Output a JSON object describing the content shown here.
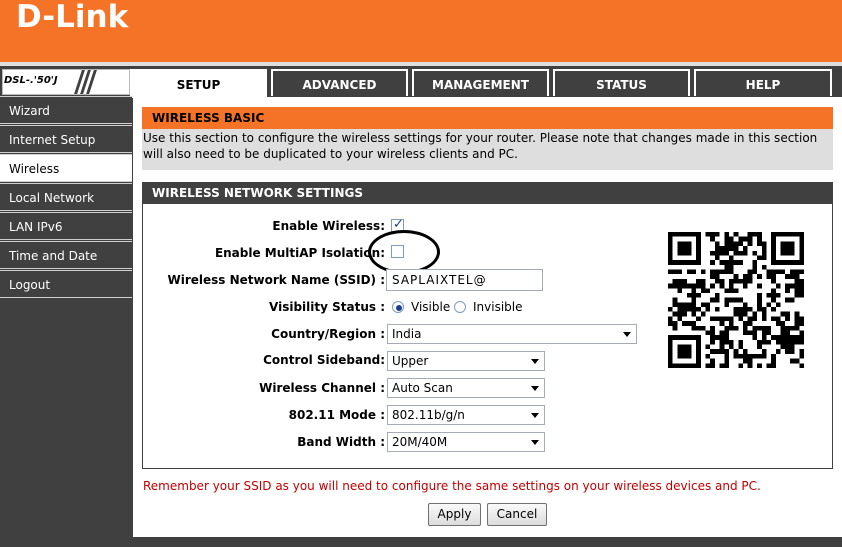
{
  "brand": {
    "logo_text": "D-Link",
    "model": "DSL-.'50'J",
    "accent": "#f47326"
  },
  "tabs": [
    {
      "label": "SETUP",
      "active": true
    },
    {
      "label": "ADVANCED",
      "active": false
    },
    {
      "label": "MANAGEMENT",
      "active": false
    },
    {
      "label": "STATUS",
      "active": false
    },
    {
      "label": "HELP",
      "active": false
    }
  ],
  "sidebar": [
    {
      "label": "Wizard",
      "active": false
    },
    {
      "label": "Internet Setup",
      "active": false
    },
    {
      "label": "Wireless",
      "active": true
    },
    {
      "label": "Local Network",
      "active": false
    },
    {
      "label": "LAN IPv6",
      "active": false
    },
    {
      "label": "Time and Date",
      "active": false
    },
    {
      "label": "Logout",
      "active": false
    }
  ],
  "wireless_basic": {
    "title": "WIRELESS BASIC",
    "description": "Use this section to configure the wireless settings for your router. Please note that changes made in this section will also need to be duplicated to your wireless clients and PC."
  },
  "settings": {
    "title": "WIRELESS NETWORK SETTINGS",
    "enable_wireless_label": "Enable Wireless:",
    "enable_wireless": true,
    "multiap_label": "Enable MultiAP Isolation:",
    "multiap": false,
    "ssid_label": "Wireless Network Name (SSID) :",
    "ssid_value": "SAPLAIXTEL@",
    "visibility_label": "Visibility Status :",
    "visible_label": "Visible",
    "invisible_label": "Invisible",
    "visibility": "Visible",
    "country_label": "Country/Region :",
    "country_value": "India",
    "sideband_label": "Control Sideband:",
    "sideband_value": "Upper",
    "channel_label": "Wireless Channel :",
    "channel_value": "Auto Scan",
    "mode_label": "802.11 Mode :",
    "mode_value": "802.11b/g/n",
    "bandwidth_label": "Band Width :",
    "bandwidth_value": "20M/40M"
  },
  "remember_text": "Remember your SSID as you will need to configure the same settings on your wireless devices and PC.",
  "buttons": {
    "apply": "Apply",
    "cancel": "Cancel"
  }
}
